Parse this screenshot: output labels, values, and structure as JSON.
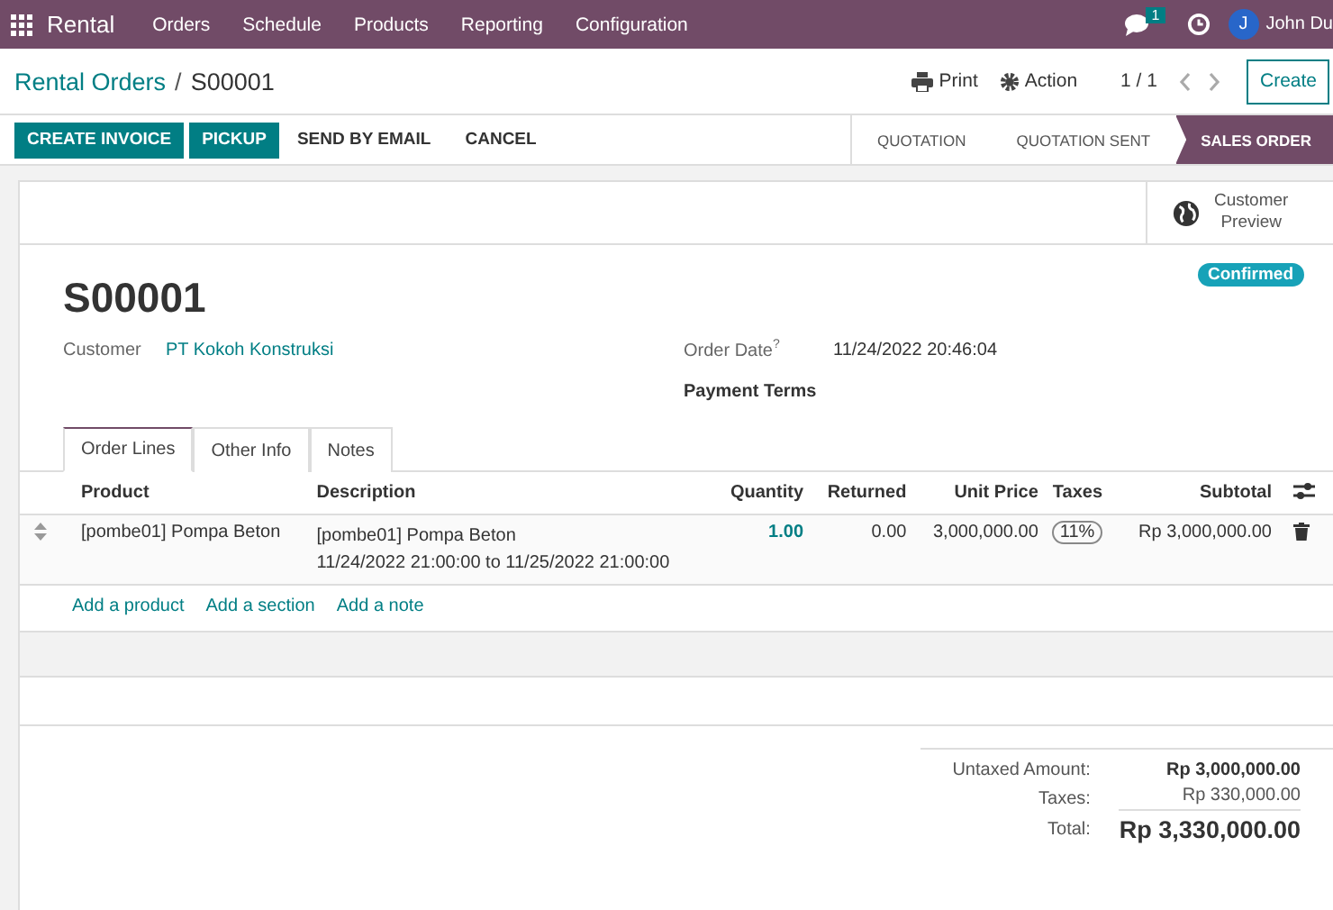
{
  "navbar": {
    "app_name": "Rental",
    "menu": [
      "Orders",
      "Schedule",
      "Products",
      "Reporting",
      "Configuration"
    ],
    "messages_badge": "1",
    "user_initial": "J",
    "user_name": "John Du"
  },
  "control_panel": {
    "breadcrumb_parent": "Rental Orders",
    "breadcrumb_separator": "/",
    "breadcrumb_current": "S00001",
    "print": "Print",
    "action": "Action",
    "pager": "1 / 1",
    "create": "Create"
  },
  "action_buttons": [
    {
      "label": "CREATE INVOICE",
      "kind": "primary"
    },
    {
      "label": "PICKUP",
      "kind": "primary"
    },
    {
      "label": "SEND BY EMAIL",
      "kind": "secondary"
    },
    {
      "label": "CANCEL",
      "kind": "secondary"
    }
  ],
  "stages": [
    {
      "label": "QUOTATION",
      "selected": false
    },
    {
      "label": "QUOTATION SENT",
      "selected": false
    },
    {
      "label": "SALES ORDER",
      "selected": true
    }
  ],
  "smart_button": {
    "label_line1": "Customer",
    "label_line2": "Preview"
  },
  "order": {
    "name": "S00001",
    "status": "Confirmed",
    "customer_label": "Customer",
    "customer": "PT Kokoh Konstruksi",
    "order_date_label": "Order Date",
    "help_mark": "?",
    "order_date": "11/24/2022 20:46:04",
    "payment_terms_label": "Payment Terms"
  },
  "tabs": [
    {
      "label": "Order Lines",
      "selected": true
    },
    {
      "label": "Other Info",
      "selected": false
    },
    {
      "label": "Notes",
      "selected": false
    }
  ],
  "table": {
    "columns": [
      "Product",
      "Description",
      "Quantity",
      "Returned",
      "Unit Price",
      "Taxes",
      "Subtotal"
    ],
    "rows": [
      {
        "product": "[pombe01] Pompa Beton",
        "description_line1": "[pombe01] Pompa Beton",
        "description_line2": "11/24/2022 21:00:00 to 11/25/2022 21:00:00",
        "quantity": "1.00",
        "returned": "0.00",
        "unit_price": "3,000,000.00",
        "tax": "11%",
        "subtotal": "Rp 3,000,000.00"
      }
    ],
    "add_links": [
      "Add a product",
      "Add a section",
      "Add a note"
    ]
  },
  "totals": [
    {
      "label": "Untaxed Amount:",
      "value": "Rp 3,000,000.00",
      "kind": "strong"
    },
    {
      "label": "Taxes:",
      "value": "Rp 330,000.00",
      "kind": "plain"
    },
    {
      "label": "Total:",
      "value": "Rp 3,330,000.00",
      "kind": "grand"
    }
  ]
}
